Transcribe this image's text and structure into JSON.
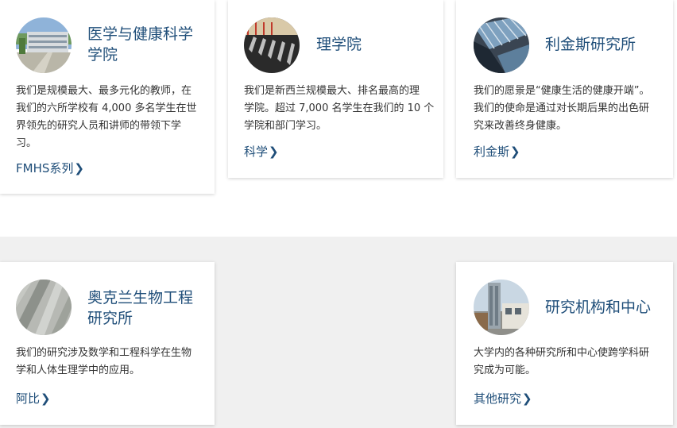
{
  "cards": [
    {
      "title": "医学与健康科学学院",
      "title_line1": "医学与健康科学",
      "title_line2": "学院",
      "desc_lines": [
        "我们是规模最大、最多元化的教师，在",
        "我们的六所学校有 4,000 多名学生在世",
        "界领先的研究人员和讲师的带领下学",
        "习。"
      ],
      "link": "FMHS系列",
      "thumb_icon": "campus-building-photo"
    },
    {
      "title": "理学院",
      "desc_lines": [
        "我们是新西兰规模最大、排名最高的理",
        "学院。超过 7,000 名学生在我们的 10 个",
        "学院和部门学习。"
      ],
      "link": "科学",
      "thumb_icon": "lab-structure-photo"
    },
    {
      "title": "利金斯研究所",
      "desc_lines": [
        "我们的愿景是“健康生活的健康开端”。",
        "我们的使命是通过对长期后果的出色研",
        "究来改善终身健康。"
      ],
      "link": "利金斯",
      "thumb_icon": "glass-facade-photo"
    },
    {
      "title": "奥克兰生物工程研究所",
      "title_line1": "奥克兰生物工程",
      "title_line2": "研究所",
      "desc_lines": [
        "我们的研究涉及数学和工程科学在生物",
        "学和人体生理学中的应用。"
      ],
      "link": "阿比",
      "thumb_icon": "abstract-blur-photo"
    },
    {
      "title": "研究机构和中心",
      "desc_lines": [
        "大学内的各种研究所和中心使跨学科研",
        "究成为可能。"
      ],
      "link": "其他研究",
      "thumb_icon": "tower-building-photo"
    }
  ],
  "chevron": "❯",
  "colors": {
    "accent": "#1f4e79",
    "text": "#333333",
    "band": "#f0f0f0"
  }
}
